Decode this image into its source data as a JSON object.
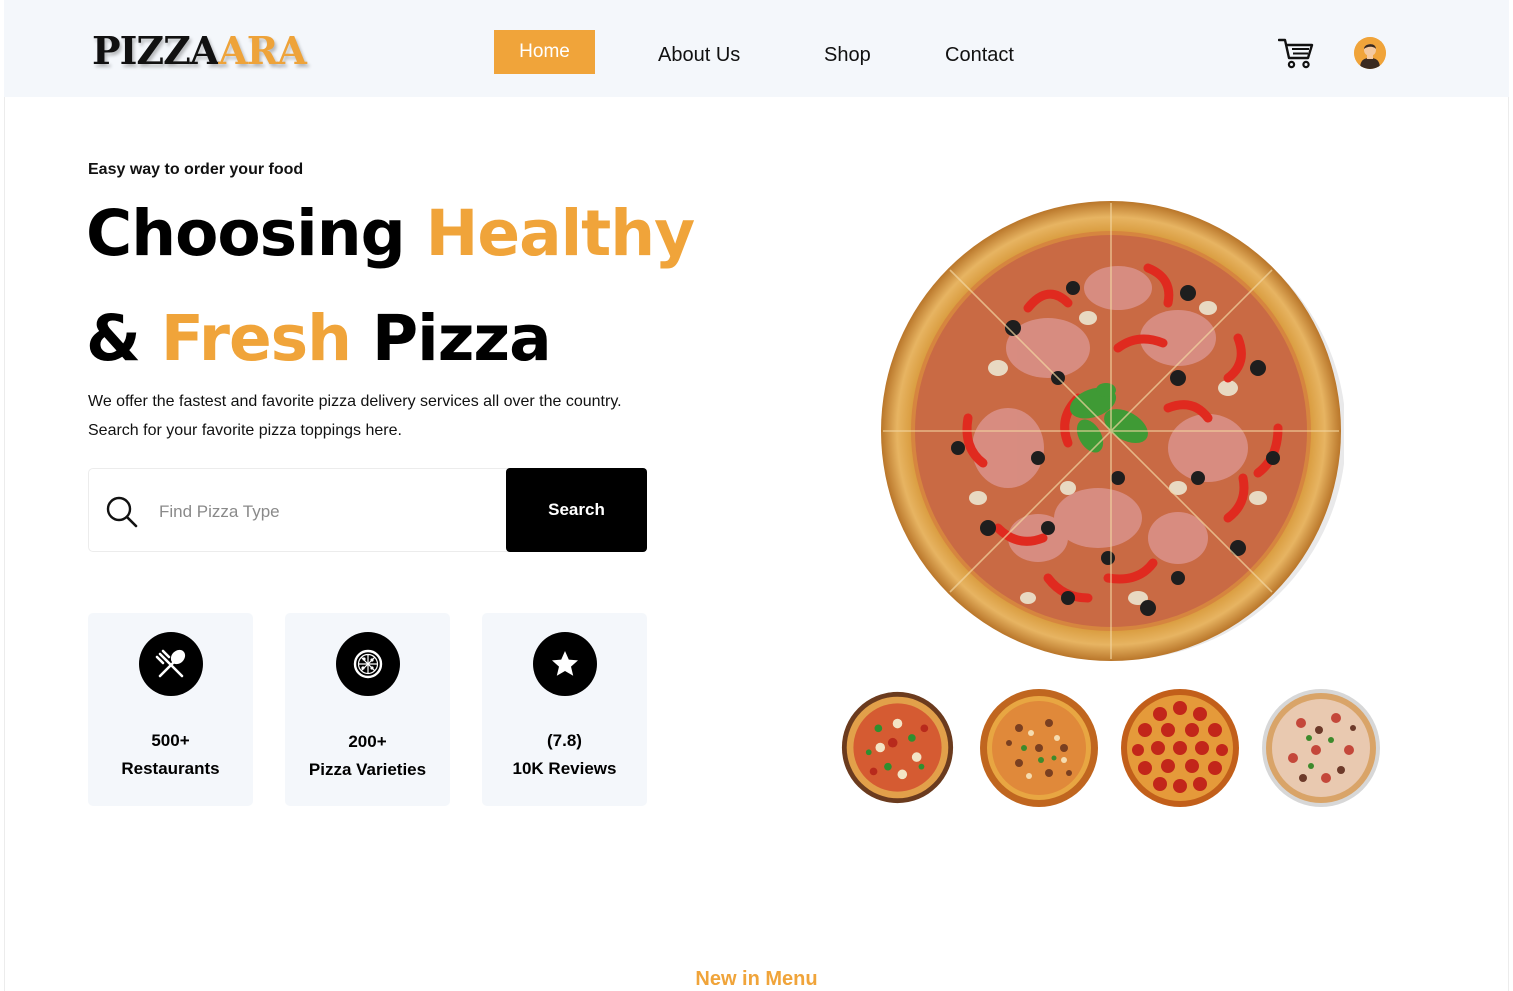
{
  "brand": {
    "logo_part1": "PIZZA",
    "logo_part2": "ARA"
  },
  "nav": {
    "home": "Home",
    "about": "About Us",
    "shop": "Shop",
    "contact": "Contact"
  },
  "hero": {
    "eyebrow": "Easy way to order your food",
    "title_line1_a": "Choosing ",
    "title_line1_b": "Healthy",
    "title_line2_a": "& ",
    "title_line2_b": "Fresh",
    "title_line2_c": " Pizza",
    "desc_line1": "We offer the fastest and favorite pizza delivery services all over the country.",
    "desc_line2": "Search for your favorite pizza toppings here."
  },
  "search": {
    "placeholder": "Find Pizza Type",
    "value": "",
    "button": "Search"
  },
  "stats": [
    {
      "icon": "fork-spoon-icon",
      "value": "500+",
      "label": "Restaurants"
    },
    {
      "icon": "pizza-icon",
      "value": "200+",
      "label": "Pizza Varieties"
    },
    {
      "icon": "star-icon",
      "value": "(7.8)",
      "label": "10K Reviews"
    }
  ],
  "sections": {
    "new_in_menu": "New in Menu"
  },
  "colors": {
    "accent": "#f0a43a",
    "header_bg": "#f4f7fb",
    "card_bg": "#f4f7fb",
    "dark": "#000000"
  }
}
